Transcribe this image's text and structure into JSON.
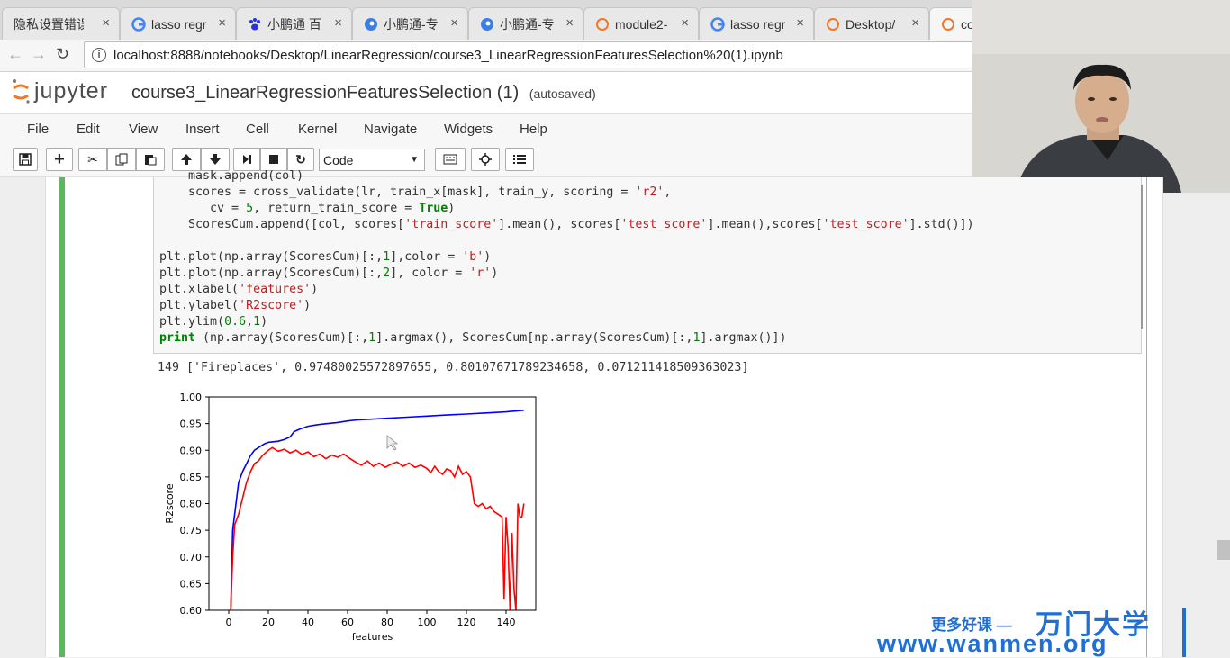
{
  "browser": {
    "tabs": [
      {
        "title": "隐私设置错误",
        "icon": "warning-icon"
      },
      {
        "title": "lasso regr",
        "icon": "google-icon"
      },
      {
        "title": "小鹏通 百",
        "icon": "baidu-paw-icon"
      },
      {
        "title": "小鹏通-专",
        "icon": "blue-circle-icon"
      },
      {
        "title": "小鹏通-专",
        "icon": "blue-circle-icon"
      },
      {
        "title": "module2-",
        "icon": "jupyter-icon"
      },
      {
        "title": "lasso regr",
        "icon": "google-icon"
      },
      {
        "title": "Desktop/",
        "icon": "jupyter-icon"
      },
      {
        "title": "co",
        "icon": "jupyter-icon"
      }
    ],
    "url": "localhost:8888/notebooks/Desktop/LinearRegression/course3_LinearRegressionFeaturesSelection%20(1).ipynb"
  },
  "jupyter": {
    "logo_text": "jupyter",
    "notebook_title": "course3_LinearRegressionFeaturesSelection (1)",
    "save_status": "(autosaved)",
    "menus": [
      "File",
      "Edit",
      "View",
      "Insert",
      "Cell",
      "Kernel",
      "Navigate",
      "Widgets",
      "Help"
    ],
    "cell_type": "Code"
  },
  "code_lines": [
    "    mask.append(col)",
    "    scores = cross_validate(lr, train_x[mask], train_y, scoring = 'r2',",
    "       cv = 5, return_train_score = True)",
    "    ScoresCum.append([col, scores['train_score'].mean(), scores['test_score'].mean(),scores['test_score'].std()])",
    "",
    "plt.plot(np.array(ScoresCum)[:,1],color = 'b')",
    "plt.plot(np.array(ScoresCum)[:,2], color = 'r')",
    "plt.xlabel('features')",
    "plt.ylabel('R2score')",
    "plt.ylim(0.6,1)",
    "print (np.array(ScoresCum)[:,1].argmax(), ScoresCum[np.array(ScoresCum)[:,1].argmax()])"
  ],
  "output_text": "149 ['Fireplaces', 0.97480025572897655, 0.80107671789234658, 0.071211418509363023]",
  "watermark": {
    "line1": "更多好课 —",
    "brand": "万门大学",
    "url": "www.wanmen.org"
  },
  "chart_data": {
    "type": "line",
    "xlabel": "features",
    "ylabel": "R2score",
    "xlim": [
      -10,
      155
    ],
    "ylim": [
      0.6,
      1.0
    ],
    "xticks": [
      0,
      20,
      40,
      60,
      80,
      100,
      120,
      140
    ],
    "yticks": [
      0.6,
      0.65,
      0.7,
      0.75,
      0.8,
      0.85,
      0.9,
      0.95,
      1.0
    ],
    "series": [
      {
        "color": "#0000ff",
        "points": [
          [
            1,
            0.6
          ],
          [
            2,
            0.75
          ],
          [
            3,
            0.78
          ],
          [
            5,
            0.84
          ],
          [
            7,
            0.86
          ],
          [
            9,
            0.875
          ],
          [
            11,
            0.89
          ],
          [
            13,
            0.9
          ],
          [
            15,
            0.905
          ],
          [
            18,
            0.912
          ],
          [
            20,
            0.915
          ],
          [
            25,
            0.917
          ],
          [
            28,
            0.92
          ],
          [
            31,
            0.925
          ],
          [
            33,
            0.935
          ],
          [
            36,
            0.94
          ],
          [
            40,
            0.945
          ],
          [
            45,
            0.948
          ],
          [
            50,
            0.95
          ],
          [
            55,
            0.952
          ],
          [
            60,
            0.955
          ],
          [
            65,
            0.957
          ],
          [
            70,
            0.958
          ],
          [
            80,
            0.96
          ],
          [
            90,
            0.962
          ],
          [
            100,
            0.964
          ],
          [
            110,
            0.966
          ],
          [
            120,
            0.968
          ],
          [
            130,
            0.97
          ],
          [
            140,
            0.972
          ],
          [
            149,
            0.975
          ]
        ]
      },
      {
        "color": "#ff0000",
        "points": [
          [
            1,
            0.6
          ],
          [
            2,
            0.7
          ],
          [
            3,
            0.76
          ],
          [
            5,
            0.78
          ],
          [
            7,
            0.81
          ],
          [
            9,
            0.84
          ],
          [
            11,
            0.86
          ],
          [
            13,
            0.875
          ],
          [
            15,
            0.88
          ],
          [
            17,
            0.89
          ],
          [
            20,
            0.9
          ],
          [
            22,
            0.905
          ],
          [
            25,
            0.898
          ],
          [
            28,
            0.902
          ],
          [
            31,
            0.895
          ],
          [
            34,
            0.9
          ],
          [
            37,
            0.892
          ],
          [
            40,
            0.897
          ],
          [
            43,
            0.888
          ],
          [
            46,
            0.893
          ],
          [
            49,
            0.884
          ],
          [
            52,
            0.891
          ],
          [
            55,
            0.887
          ],
          [
            58,
            0.893
          ],
          [
            61,
            0.885
          ],
          [
            64,
            0.878
          ],
          [
            67,
            0.872
          ],
          [
            70,
            0.88
          ],
          [
            73,
            0.87
          ],
          [
            76,
            0.876
          ],
          [
            79,
            0.868
          ],
          [
            82,
            0.874
          ],
          [
            85,
            0.878
          ],
          [
            88,
            0.87
          ],
          [
            91,
            0.876
          ],
          [
            94,
            0.868
          ],
          [
            97,
            0.872
          ],
          [
            100,
            0.866
          ],
          [
            102,
            0.858
          ],
          [
            104,
            0.87
          ],
          [
            106,
            0.86
          ],
          [
            108,
            0.855
          ],
          [
            110,
            0.865
          ],
          [
            112,
            0.862
          ],
          [
            114,
            0.85
          ],
          [
            116,
            0.87
          ],
          [
            118,
            0.855
          ],
          [
            120,
            0.86
          ],
          [
            122,
            0.85
          ],
          [
            124,
            0.8
          ],
          [
            126,
            0.795
          ],
          [
            128,
            0.8
          ],
          [
            130,
            0.79
          ],
          [
            132,
            0.795
          ],
          [
            134,
            0.785
          ],
          [
            136,
            0.78
          ],
          [
            138,
            0.775
          ],
          [
            139,
            0.62
          ],
          [
            140,
            0.775
          ],
          [
            141,
            0.72
          ],
          [
            142,
            0.6
          ],
          [
            143,
            0.745
          ],
          [
            144,
            0.64
          ],
          [
            145,
            0.6
          ],
          [
            146,
            0.8
          ],
          [
            147,
            0.775
          ],
          [
            148,
            0.775
          ],
          [
            149,
            0.8
          ]
        ]
      }
    ]
  }
}
